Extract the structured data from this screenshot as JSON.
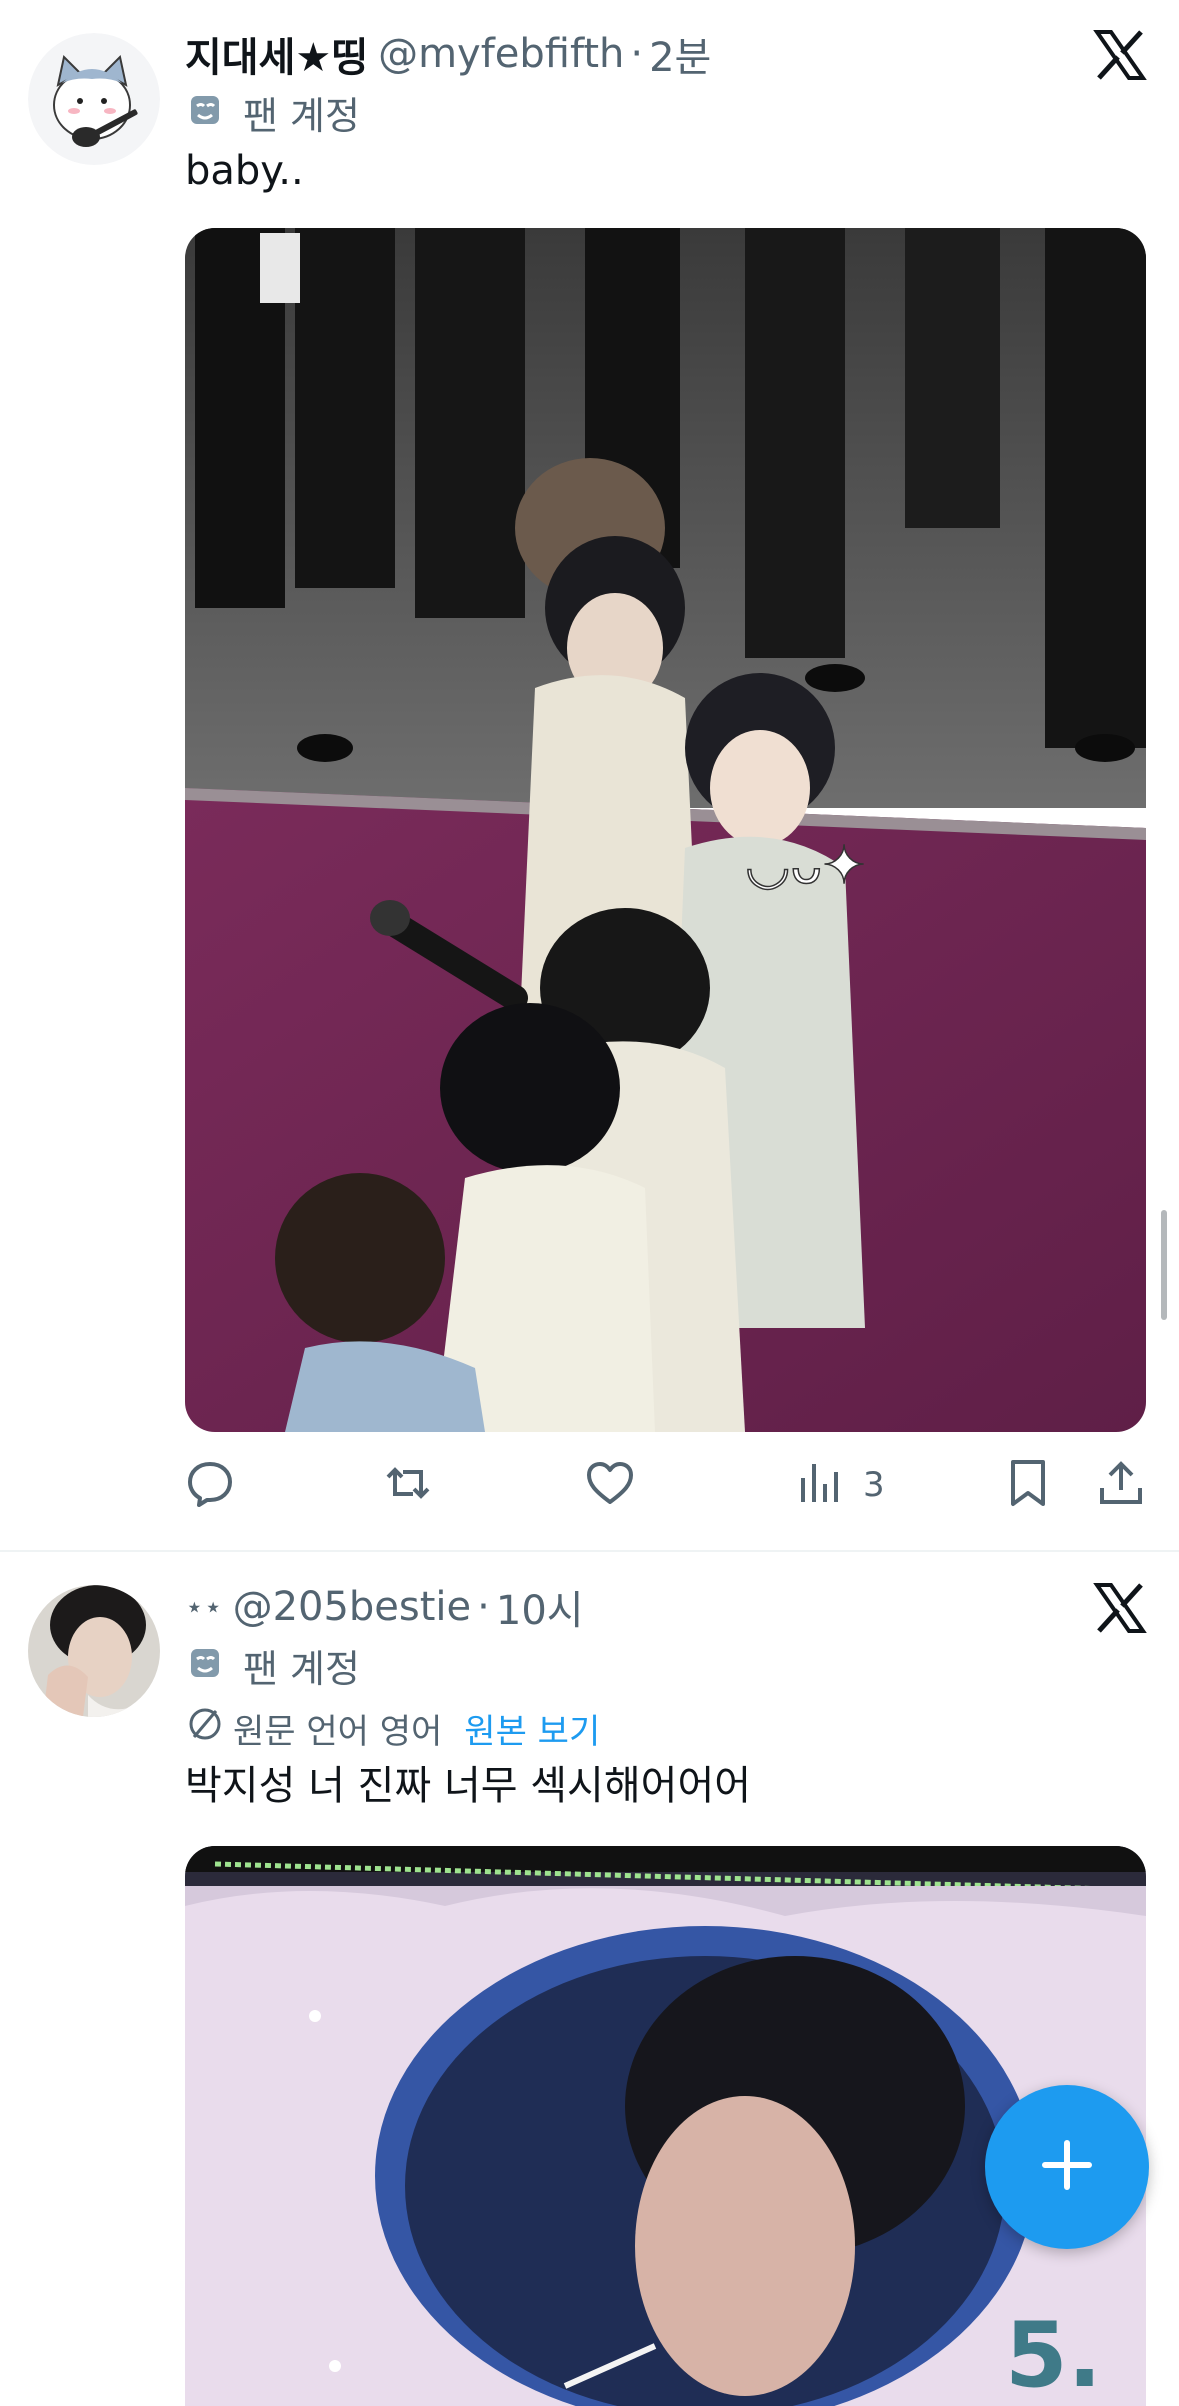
{
  "tweets": [
    {
      "display_name": "지대세★띵",
      "handle": "@myfebfifth",
      "separator": "·",
      "time": "2분",
      "fan_label": "팬 계정",
      "text": "baby..",
      "stats": {
        "views": "3"
      },
      "media_icon": "cat-guitar-avatar"
    },
    {
      "display_name": "⋆⋆",
      "handle": "@205bestie",
      "separator": "·",
      "time": "10시",
      "fan_label": "팬 계정",
      "translation": {
        "label": "원문 언어 영어",
        "link": "원본 보기"
      },
      "text": "박지성 너 진짜 너무 섹시해어어어"
    }
  ],
  "colors": {
    "accent": "#1d9bf0",
    "secondary_text": "#536471",
    "primary_text": "#0f1419",
    "divider": "#eff3f4"
  },
  "icons": [
    "reply-icon",
    "retweet-icon",
    "like-icon",
    "views-icon",
    "bookmark-icon",
    "share-icon",
    "x-logo-icon",
    "fan-mask-icon",
    "translate-icon",
    "plus-icon"
  ]
}
